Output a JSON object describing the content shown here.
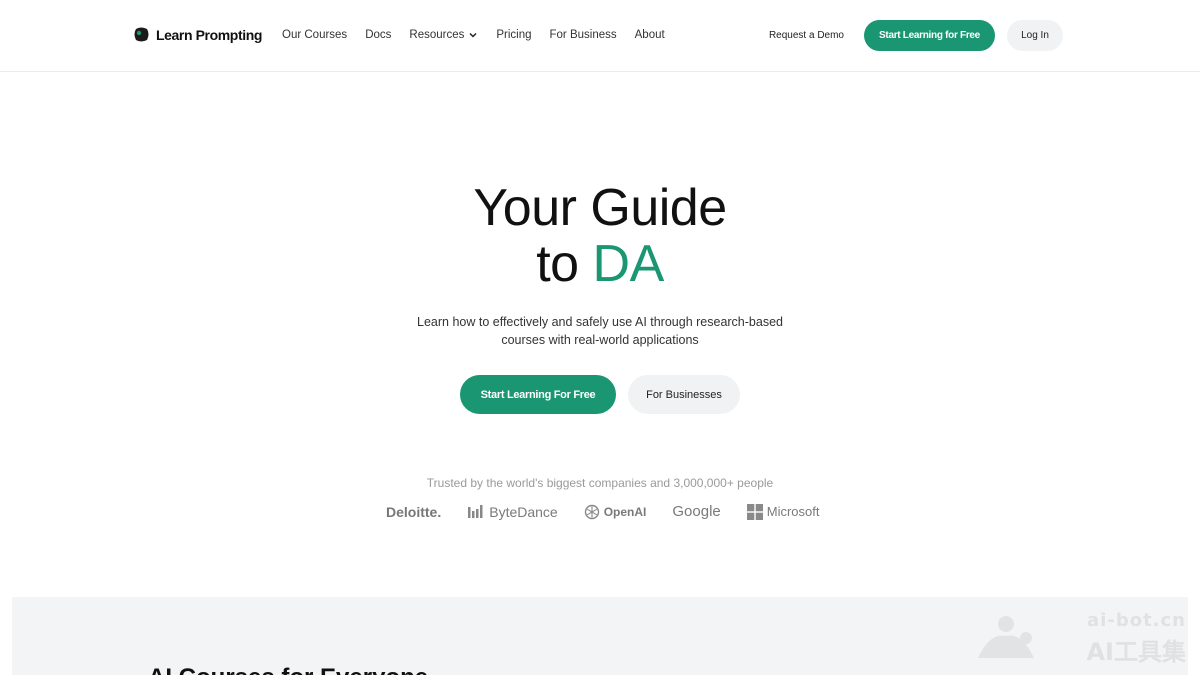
{
  "nav": {
    "logo_text": "Learn Prompting",
    "links": [
      "Our Courses",
      "Docs",
      "Resources",
      "Pricing",
      "For Business",
      "About"
    ],
    "request_demo": "Request a Demo",
    "start_free": "Start Learning for Free",
    "login": "Log In"
  },
  "hero": {
    "title_line1": "Your Guide",
    "title_line2_prefix": "to ",
    "title_line2_accent": "DA",
    "subtitle_line1": "Learn how to effectively and safely use AI through research-based",
    "subtitle_line2": "courses with real-world applications",
    "cta_primary": "Start Learning For Free",
    "cta_secondary": "For Businesses"
  },
  "trusted": {
    "text": "Trusted by the world's biggest companies and 3,000,000+ people",
    "brands": [
      "Deloitte.",
      "ByteDance",
      "OpenAI",
      "Google",
      "Microsoft"
    ]
  },
  "section": {
    "heading": "AI Courses for Everyone"
  },
  "watermark": {
    "top": "ai-bot.cn",
    "bottom": "AI工具集"
  },
  "colors": {
    "accent": "#1a9672",
    "button_grey": "#f1f2f4",
    "panel": "#f3f4f5"
  }
}
